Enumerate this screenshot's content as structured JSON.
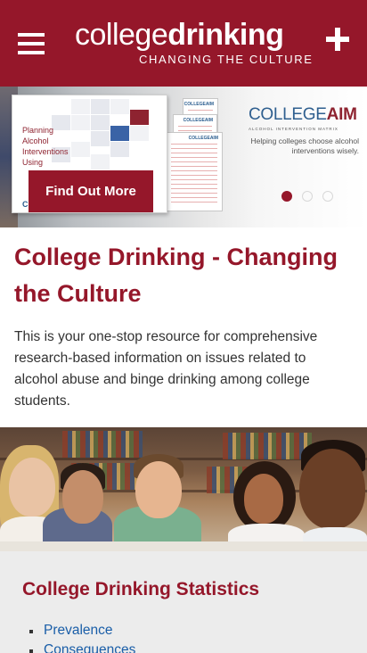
{
  "header": {
    "logo_light": "college",
    "logo_bold": "drinking",
    "logo_tagline": "CHANGING THE CULTURE",
    "menu_icon": "hamburger-menu-icon",
    "plus_icon": "plus-icon",
    "background_color": "#95172a"
  },
  "hero": {
    "document_title": "Planning Alcohol Interventions Using",
    "document_headers": [
      "COLLEGEAIM",
      "COLLEGEAIM",
      "COLLEGEAIM"
    ],
    "button_label": "Find Out More",
    "aim_logo_light": "COLLEGE",
    "aim_logo_bold": "AIM",
    "aim_logo_subtitle": "ALCOHOL INTERVENTION MATRIX",
    "aim_tagline": "Helping colleges choose alcohol interventions wisely.",
    "slide_count": 3,
    "active_slide": 1
  },
  "main": {
    "title": "College Drinking - Changing the Culture",
    "intro": "This is your one-stop resource for comprehensive research-based information on issues related to alcohol abuse and binge drinking among college students."
  },
  "stats": {
    "title": "College Drinking Statistics",
    "links": [
      "Prevalence",
      "Consequences"
    ]
  },
  "colors": {
    "brand": "#95172a",
    "link": "#1a5ea8",
    "stats_background": "#ececec"
  }
}
